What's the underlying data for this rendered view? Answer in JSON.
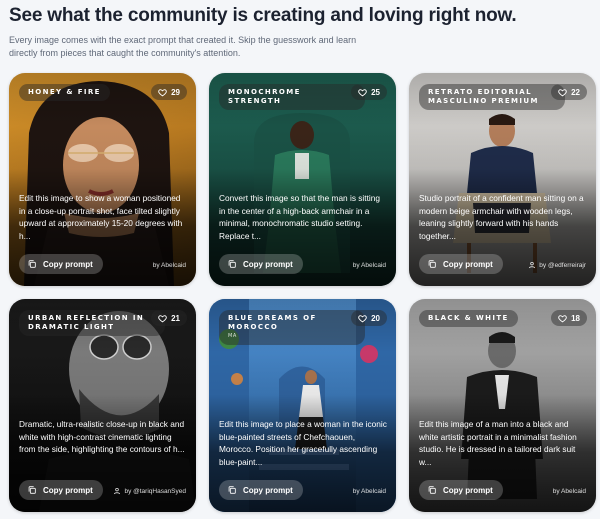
{
  "header": {
    "title": "See what the community is creating and loving right now.",
    "subtitle": "Every image comes with the exact prompt that created it. Skip the guesswork and learn directly from pieces that caught the community's attention."
  },
  "cards": [
    {
      "tag": "HONEY & FIRE",
      "likes": "29",
      "description": "Edit this image to show a woman positioned in a close-up portrait shot, face tilted slightly upward at approximately 15-20 degrees with h...",
      "copy_label": "Copy prompt",
      "author": "by Abelcaid",
      "author_icon": "none",
      "bg_color": "#b57a22"
    },
    {
      "tag": "MONOCHROME STRENGTH",
      "likes": "25",
      "description": "Convert this image so that the man is sitting in the center of a high-back armchair in a minimal, monochromatic studio setting. Replace t...",
      "copy_label": "Copy prompt",
      "author": "by Abelcaid",
      "author_icon": "none",
      "bg_color": "#1f5a4c"
    },
    {
      "tag": "RETRATO EDITORIAL MASCULINO PREMIUM",
      "likes": "22",
      "description": "Studio portrait of a confident man sitting on a modern beige armchair with wooden legs, leaning slightly forward with his hands together...",
      "copy_label": "Copy prompt",
      "author": "by @edferreirajr",
      "author_icon": "user-icon",
      "bg_color": "#c8c6c4"
    },
    {
      "tag": "URBAN REFLECTION IN DRAMATIC LIGHT",
      "likes": "21",
      "description": "Dramatic, ultra-realistic close-up in black and white with high-contrast cinematic lighting from the side, highlighting the contours of h...",
      "copy_label": "Copy prompt",
      "author": "by @tariqHasanSyed",
      "author_icon": "user-icon",
      "bg_color": "#161616"
    },
    {
      "tag": "BLUE DREAMS OF MOROCCO",
      "tag_sub": "MA",
      "likes": "20",
      "description": "Edit this image to place a woman in the iconic blue-painted streets of Chefchaouen, Morocco. Position her gracefully ascending blue-paint...",
      "copy_label": "Copy prompt",
      "author": "by Abelcaid",
      "author_icon": "none",
      "bg_color": "#3f79b8"
    },
    {
      "tag": "BLACK & WHITE",
      "likes": "18",
      "description": "Edit this image of a man into a black and white artistic portrait in a minimalist fashion studio. He is dressed in a tailored dark suit w...",
      "copy_label": "Copy prompt",
      "author": "by Abelcaid",
      "author_icon": "none",
      "bg_color": "#9a9a9a"
    }
  ]
}
